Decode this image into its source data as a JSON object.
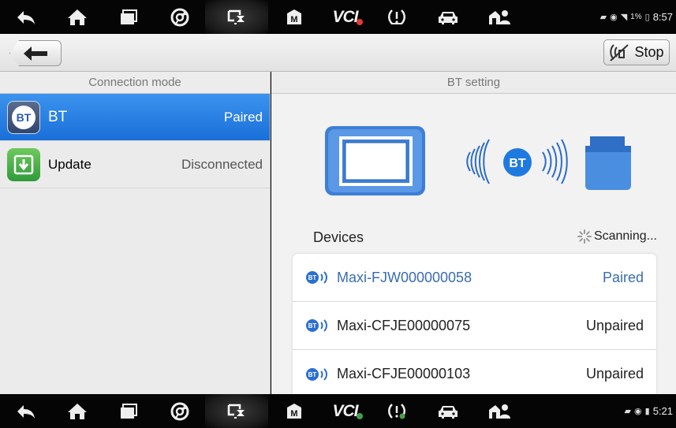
{
  "status_bar_top": {
    "time": "8:57",
    "battery": "1%",
    "vci_badge_color": "#e53935"
  },
  "status_bar_bottom": {
    "time": "5:21",
    "vci_badge_color": "#43a047"
  },
  "nav_icons": [
    "back-icon",
    "home-icon",
    "recent-apps-icon",
    "chrome-icon",
    "remote-desk-icon",
    "maxifix-icon",
    "vci-icon",
    "tpms-icon",
    "car-icon",
    "support-icon"
  ],
  "vci_label": "VCI",
  "toolbar": {
    "stop_label": "Stop"
  },
  "left_panel": {
    "header": "Connection mode",
    "items": [
      {
        "label": "BT",
        "status": "Paired",
        "icon_text": "BT",
        "active": true
      },
      {
        "label": "Update",
        "status": "Disconnected",
        "active": false
      }
    ]
  },
  "right_panel": {
    "header": "BT setting",
    "bt_badge": "BT",
    "devices_label": "Devices",
    "scanning_label": "Scanning...",
    "devices": [
      {
        "name": "Maxi-FJW000000058",
        "status": "Paired"
      },
      {
        "name": "Maxi-CFJE00000075",
        "status": "Unpaired"
      },
      {
        "name": "Maxi-CFJE00000103",
        "status": "Unpaired"
      }
    ],
    "device_icon_text": "BT"
  },
  "colors": {
    "accent_blue": "#1f75dd",
    "paired_text": "#3a6cb0",
    "update_green": "#4caf50"
  }
}
